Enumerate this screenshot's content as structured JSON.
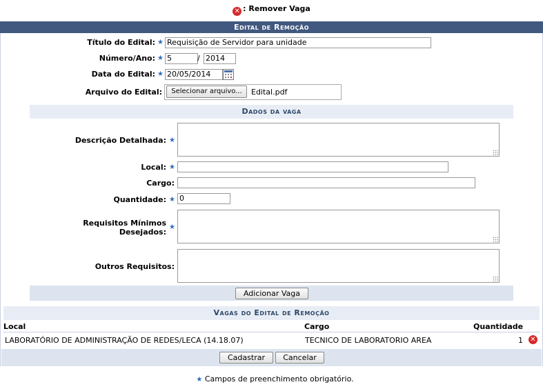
{
  "top_legend": {
    "text": ": Remover Vaga",
    "icon": "remove-icon"
  },
  "form": {
    "title": "Edital de Remoção",
    "titulo_label": "Título do Edital:",
    "titulo_value": "Requisição de Servidor para unidade",
    "numero_label": "Número/Ano:",
    "numero_value": "5",
    "ano_separator": "/",
    "ano_value": "2014",
    "data_label": "Data do Edital:",
    "data_value": "20/05/2014",
    "arquivo_label": "Arquivo do Edital:",
    "arquivo_button": "Selecionar arquivo...",
    "arquivo_name": "Edital.pdf"
  },
  "vaga": {
    "title": "Dados da vaga",
    "descricao_label": "Descrição Detalhada:",
    "descricao_value": "",
    "local_label": "Local:",
    "local_value": "",
    "cargo_label": "Cargo:",
    "cargo_value": "",
    "quantidade_label": "Quantidade:",
    "quantidade_value": "0",
    "requisitos_label_1": "Requisitos Mínimos",
    "requisitos_label_2": "Desejados:",
    "requisitos_value": "",
    "outros_label": "Outros Requisitos:",
    "outros_value": "",
    "add_button": "Adicionar Vaga"
  },
  "vagas_table": {
    "title": "Vagas do Edital de Remoção",
    "headers": {
      "local": "Local",
      "cargo": "Cargo",
      "quantidade": "Quantidade"
    },
    "rows": [
      {
        "local": "LABORATÓRIO DE ADMINISTRAÇÃO DE REDES/LECA (14.18.07)",
        "cargo": "TECNICO DE LABORATORIO AREA",
        "quantidade": "1"
      }
    ]
  },
  "actions": {
    "cadastrar": "Cadastrar",
    "cancelar": "Cancelar"
  },
  "footer": {
    "note": "Campos de preenchimento obrigatório."
  },
  "colors": {
    "header_dark": "#41597f",
    "band": "#dde4ef",
    "required_star": "#2c6bb8",
    "remove_icon": "#d62a2a"
  }
}
